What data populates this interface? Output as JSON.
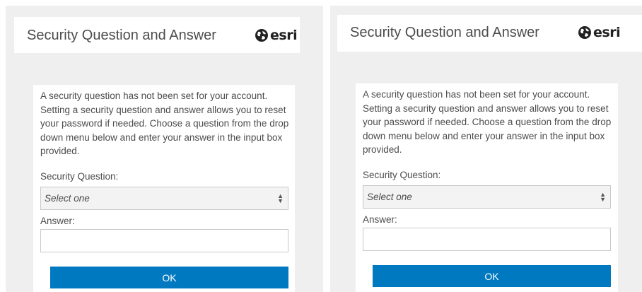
{
  "dialogs": [
    {
      "title": "Security Question and Answer",
      "logo_text": "esri",
      "intro": "A security question has not been set for your account. Setting a security question and answer allows you to reset your password if needed. Choose a question from the drop down menu below and enter your answer in the input box provided.",
      "question_label": "Security Question:",
      "select_value": "Select one",
      "answer_label": "Answer:",
      "answer_value": "",
      "ok_label": "OK"
    },
    {
      "title": "Security Question and Answer",
      "logo_text": "esri",
      "intro": "A security question has not been set for your account. Setting a security question and answer allows you to reset your password if needed. Choose a question from the drop down menu below and enter your answer in the input box provided.",
      "question_label": "Security Question:",
      "select_value": "Select one",
      "answer_label": "Answer:",
      "answer_value": "",
      "ok_label": "OK"
    }
  ],
  "colors": {
    "panel_bg": "#efefef",
    "button_bg": "#0079c1",
    "text": "#4c4c4c"
  }
}
